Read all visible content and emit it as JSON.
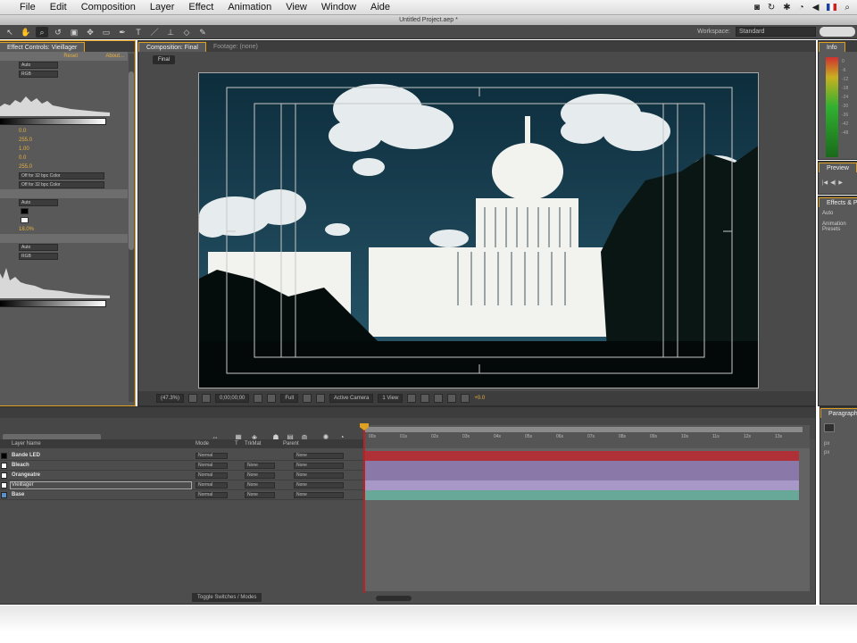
{
  "menubar": {
    "apple": "",
    "items": [
      "File",
      "Edit",
      "Composition",
      "Layer",
      "Effect",
      "Animation",
      "View",
      "Window",
      "Aide"
    ]
  },
  "window": {
    "title": "Untitled Project.aep *"
  },
  "workspace": {
    "label": "Workspace:",
    "value": "Standard"
  },
  "effect_controls": {
    "tab": "Effect Controls: Vieillager",
    "reset_label": "Reset",
    "about_label": "About...",
    "channel_label": "Auto",
    "channel_value": "RGB",
    "values": [
      "0.0",
      "255.0",
      "1.00",
      "0.0",
      "255.0"
    ],
    "clip_black": "Off for 32 bpc Color",
    "clip_white": "Off for 32 bpc Color",
    "amount": "18.0%"
  },
  "composition": {
    "tab": "Composition: Final",
    "tab2": "Footage: (none)",
    "chip": "Final",
    "magnification": "(47.3%)",
    "timecode": "0;00;00;00",
    "resolution": "Full",
    "camera": "Active Camera",
    "views": "1 View",
    "exposure": "+0.0"
  },
  "info": {
    "tab": "Info",
    "ticks": [
      "0",
      "-6",
      "-12",
      "-18",
      "-24",
      "-30",
      "-36",
      "-42",
      "-48"
    ]
  },
  "preview": {
    "tab": "Preview"
  },
  "effects_presets": {
    "tab": "Effects & Presets",
    "items": [
      "Auto",
      "Animation Presets"
    ]
  },
  "timeline": {
    "columns": {
      "layer_name": "Layer Name",
      "mode": "Mode",
      "t": "T",
      "trkmat": "TrkMat",
      "parent": "Parent"
    },
    "layers": [
      {
        "name": "Bande LED",
        "color": "#000000",
        "mode": "Normal",
        "trkmat": "",
        "parent": "None",
        "bar": "#b03038"
      },
      {
        "name": "Bleach",
        "color": "#ffffff",
        "mode": "Normal",
        "trkmat": "None",
        "parent": "None",
        "bar": "#8a78a8"
      },
      {
        "name": "Orangeatre",
        "color": "#ffffff",
        "mode": "Normal",
        "trkmat": "None",
        "parent": "None",
        "bar": "#8a78a8"
      },
      {
        "name": "Vieillager",
        "color": "#ffffff",
        "mode": "Normal",
        "trkmat": "None",
        "parent": "None",
        "bar": "#a898c8"
      },
      {
        "name": "Base",
        "color": "#5a8fc8",
        "mode": "Normal",
        "trkmat": "None",
        "parent": "None",
        "bar": "#68a898"
      }
    ],
    "ruler_labels": [
      "00s",
      "01s",
      "02s",
      "03s",
      "04s",
      "05s",
      "06s",
      "07s",
      "08s",
      "09s",
      "10s",
      "11s",
      "12s",
      "13s"
    ],
    "toggle": "Toggle Switches / Modes"
  },
  "paragraph": {
    "tab": "Paragraph",
    "field1": "px",
    "field2": "px"
  }
}
